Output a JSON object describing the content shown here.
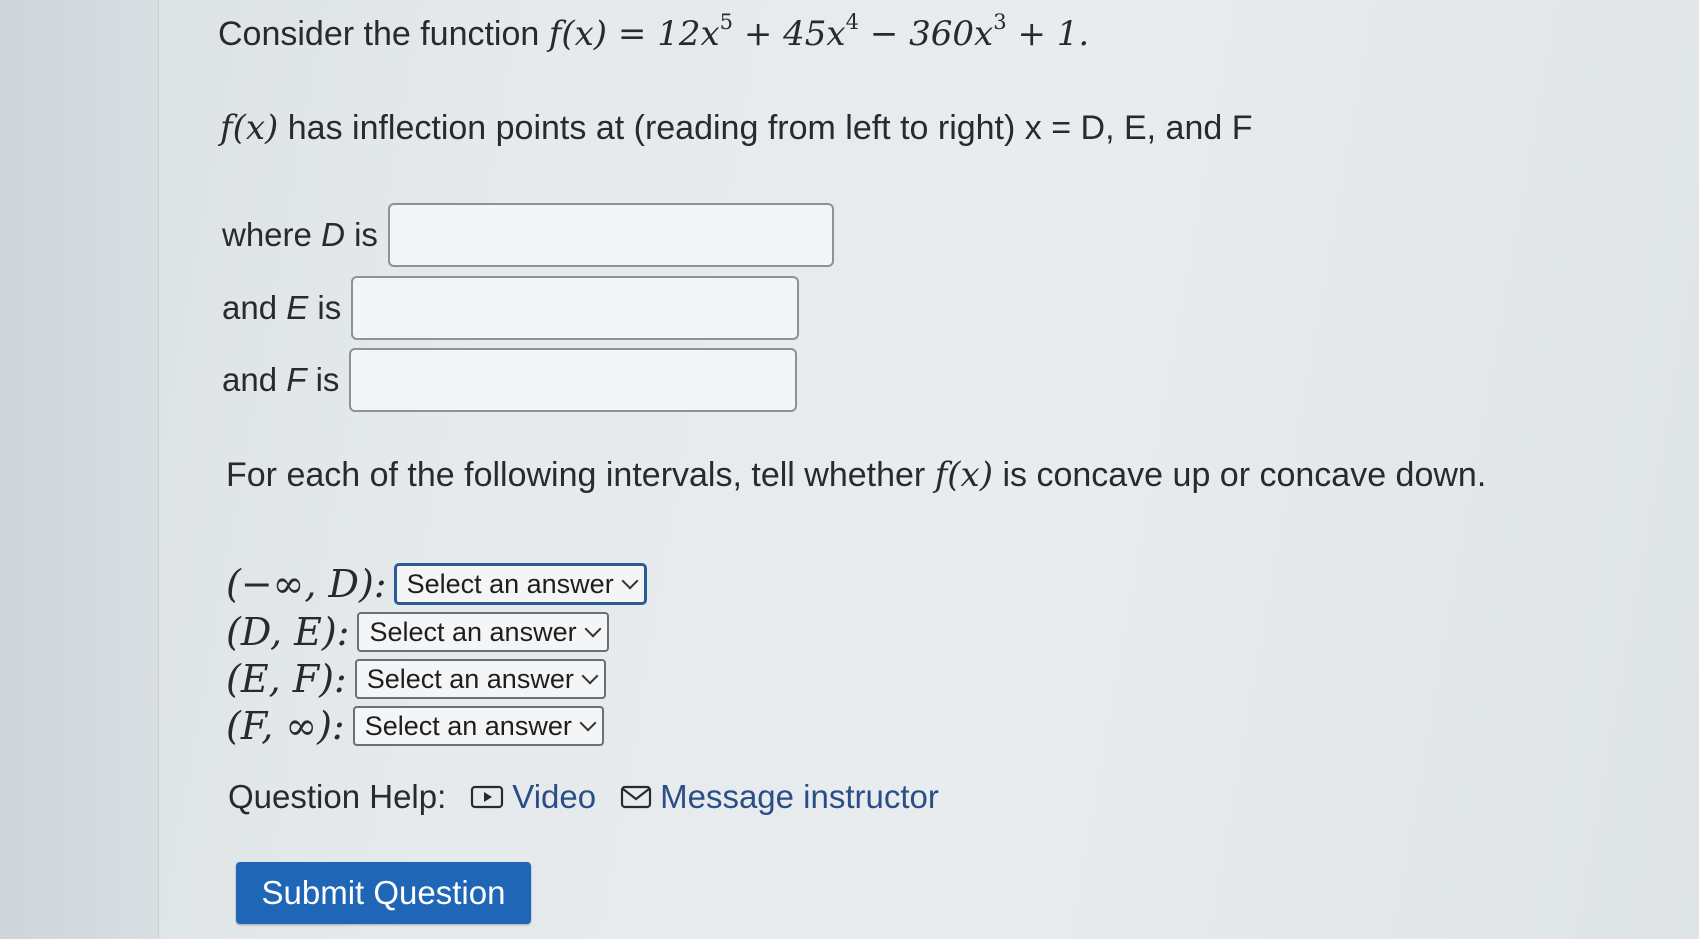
{
  "question": {
    "intro_text": "Consider the function",
    "function": {
      "lhs": "f(x)",
      "equals": "=",
      "term1_coef": "12x",
      "term1_exp": "5",
      "term2": "+ 45x",
      "term2_exp": "4",
      "term3": "− 360x",
      "term3_exp": "3",
      "term4": "+ 1."
    },
    "inflection_fx": "f(x)",
    "inflection_text": "has inflection points at (reading from left to right) x = D, E, and F",
    "answers": [
      {
        "label_pre": "where",
        "var": "D",
        "label_post": "is",
        "value": ""
      },
      {
        "label_pre": "and",
        "var": "E",
        "label_post": "is",
        "value": ""
      },
      {
        "label_pre": "and",
        "var": "F",
        "label_post": "is",
        "value": ""
      }
    ],
    "concavity_pre": "For each of the following intervals, tell whether",
    "concavity_fx": "f(x)",
    "concavity_post": "is concave up or concave down.",
    "intervals": [
      {
        "label": "(−∞, D):",
        "selected": "Select an answer"
      },
      {
        "label": "(D, E):",
        "selected": "Select an answer"
      },
      {
        "label": "(E, F):",
        "selected": "Select an answer"
      },
      {
        "label": "(F, ∞):",
        "selected": "Select an answer"
      }
    ]
  },
  "help": {
    "label": "Question Help:",
    "video_label": "Video",
    "video_icon": "play-icon",
    "message_label": "Message instructor",
    "message_icon": "envelope-icon",
    "link_color": "#2a4f88"
  },
  "submit_label": "Submit Question",
  "colors": {
    "submit_bg": "#1f67b6",
    "focus_border": "#2a5b9a"
  }
}
